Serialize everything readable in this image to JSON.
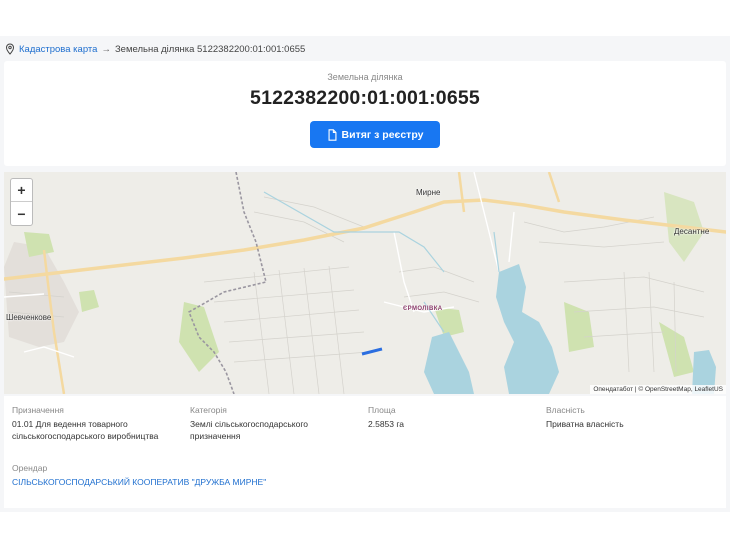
{
  "breadcrumb": {
    "root_label": "Кадастрова карта",
    "arrow": "→",
    "current_label": "Земельна ділянка 5122382200:01:001:0655"
  },
  "header": {
    "subtitle": "Земельна ділянка",
    "cadastral_number": "5122382200:01:001:0655",
    "extract_button_label": "Витяг з реєстру"
  },
  "map": {
    "zoom_in": "+",
    "zoom_out": "−",
    "attribution": "Опендатабот | © OpenStreetMap, LeafletUS",
    "labels": {
      "mirne": "Мирне",
      "desantne": "Десантне",
      "shevchenkove": "Шевченкове",
      "yermolivka": "ЄРМОЛІВКА"
    },
    "colors": {
      "road": "#f4d9a0",
      "water": "#aad3df",
      "green": "#cfe2b0",
      "parcel": "#2b6ee0"
    }
  },
  "details": {
    "purpose": {
      "label": "Призначення",
      "value_line1": "01.01 Для ведення товарного",
      "value_line2": "сільськогосподарського виробництва"
    },
    "category": {
      "label": "Категорія",
      "value_line1": "Землі сільськогосподарського",
      "value_line2": "призначення"
    },
    "area": {
      "label": "Площа",
      "value": "2.5853 га"
    },
    "ownership": {
      "label": "Власність",
      "value": "Приватна власність"
    },
    "tenant": {
      "label": "Орендар",
      "value": "СІЛЬСЬКОГОСПОДАРСЬКИЙ КООПЕРАТИВ \"ДРУЖБА МИРНЕ\""
    }
  }
}
